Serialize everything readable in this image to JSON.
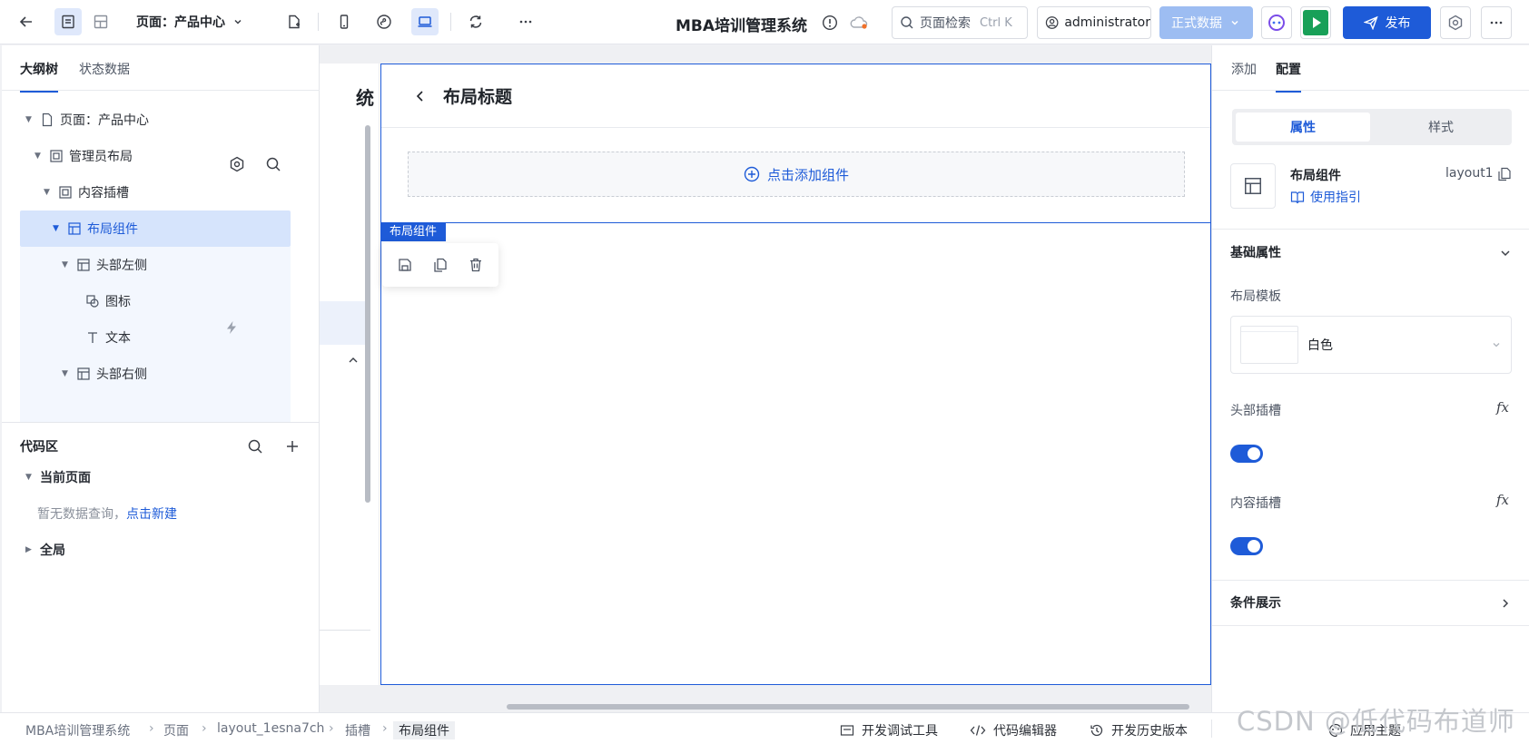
{
  "topbar": {
    "page_label": "页面：产品中心",
    "app_title": "MBA培训管理系统",
    "search_placeholder": "页面检索",
    "search_shortcut": "Ctrl K",
    "user": "administrator",
    "env": "正式数据",
    "publish": "发布"
  },
  "left": {
    "tabs": [
      "大纲树",
      "状态数据"
    ],
    "tree": [
      {
        "label": "页面：产品中心"
      },
      {
        "label": "管理员布局"
      },
      {
        "label": "内容插槽"
      },
      {
        "label": "布局组件"
      },
      {
        "label": "头部左侧"
      },
      {
        "label": "图标"
      },
      {
        "label": "文本"
      },
      {
        "label": "头部右侧"
      }
    ],
    "code": {
      "title": "代码区",
      "current_page": "当前页面",
      "empty": "暂无数据查询，",
      "create": "点击新建",
      "global": "全局"
    }
  },
  "canvas": {
    "cut_title": "统",
    "layout_title": "布局标题",
    "add_component": "点击添加组件",
    "selected_tag": "布局组件"
  },
  "right": {
    "tabs": [
      "添加",
      "配置"
    ],
    "segments": [
      "属性",
      "样式"
    ],
    "component_name": "布局组件",
    "component_id": "layout1",
    "guide": "使用指引",
    "basic_props": "基础属性",
    "template_label": "布局模板",
    "template_value": "白色",
    "header_slot": "头部插槽",
    "content_slot": "内容插槽",
    "fx": "fx",
    "conditional": "条件展示",
    "header_slot_on": true,
    "content_slot_on": true
  },
  "status": {
    "breadcrumb": [
      "MBA培训管理系统",
      "页面",
      "layout_1esna7ch",
      "插槽",
      "布局组件"
    ],
    "tools": [
      "开发调试工具",
      "代码编辑器",
      "开发历史版本",
      "应用主题"
    ],
    "watermark": "CSDN @低代码布道师"
  },
  "colors": {
    "primary": "#1e5bd8",
    "selected_row": "#d6e4fc",
    "run_green": "#18a058"
  }
}
